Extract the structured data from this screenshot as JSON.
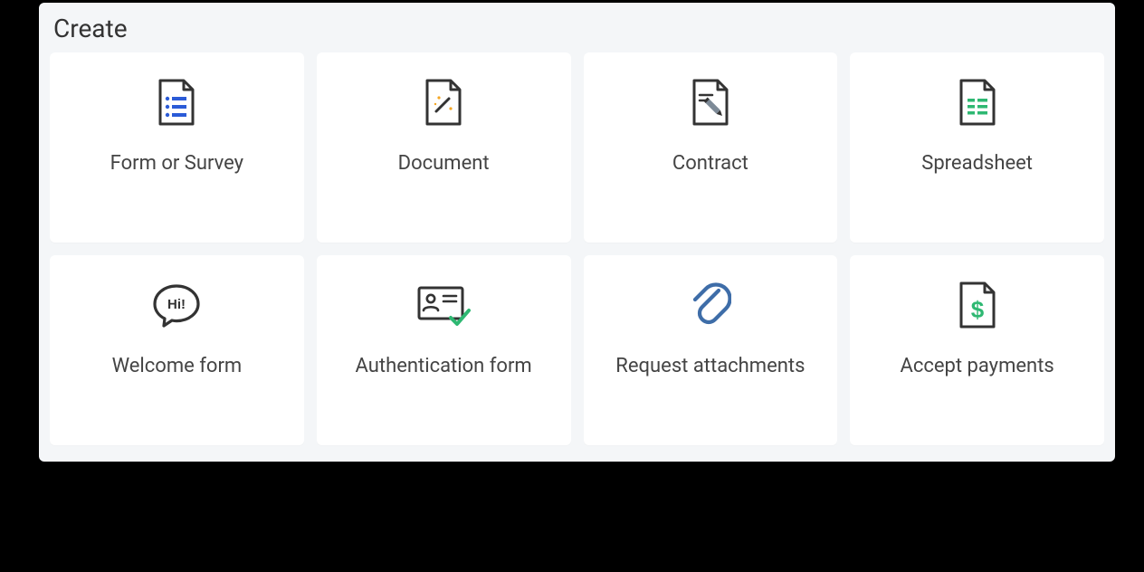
{
  "title": "Create",
  "cards": [
    {
      "label": "Form or Survey"
    },
    {
      "label": "Document"
    },
    {
      "label": "Contract"
    },
    {
      "label": "Spreadsheet"
    },
    {
      "label": "Welcome form"
    },
    {
      "label": "Authentication form"
    },
    {
      "label": "Request attachments"
    },
    {
      "label": "Accept payments"
    }
  ]
}
